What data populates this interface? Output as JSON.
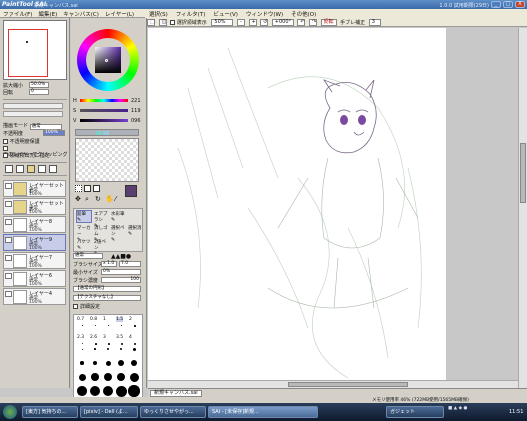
{
  "titlebar": {
    "logo": "PaintTool SAI",
    "title": "新規キャンバス.sai",
    "right": "1.0.0 試用期限(29日)",
    "min": "_",
    "max": "□",
    "close": "X"
  },
  "menubar": {
    "items": [
      "ファイル(F)",
      "編集(E)",
      "キャンバス(C)",
      "レイヤー(L)",
      "選択(S)",
      "フィルタ(T)",
      "ビュー(V)",
      "ウィンドウ(W)",
      "その他(O)"
    ]
  },
  "toolbar": {
    "show_selection": "選択領域表示",
    "zoom": "50%",
    "rotation": "+000°",
    "flip_label": "反転",
    "stabilizer_label": "手ブレ補正",
    "stabilizer": "3"
  },
  "navigator": {
    "zoom_label": "拡大縮小",
    "zoom": "50.0%",
    "angle_label": "回転",
    "angle": "0"
  },
  "left": {
    "blend_mode_label": "描画モード",
    "blend_mode": "通常",
    "opacity_label": "不透明度",
    "opacity": "100%",
    "opt1": "不透明度保護",
    "opt2": "下のレイヤーでクリッピング",
    "opt3": "領域検出元に指定",
    "layers": [
      {
        "name": "レイヤーセット1",
        "mode": "通常",
        "op": "100%",
        "folder": true,
        "sel": false
      },
      {
        "name": "レイヤーセット2",
        "mode": "通常",
        "op": "100%",
        "folder": true,
        "sel": false
      },
      {
        "name": "レイヤー8",
        "mode": "通常",
        "op": "100%",
        "folder": false,
        "sel": false
      },
      {
        "name": "レイヤー9",
        "mode": "通常",
        "op": "100%",
        "folder": false,
        "sel": true
      },
      {
        "name": "レイヤー7",
        "mode": "通常",
        "op": "100%",
        "folder": false,
        "sel": false
      },
      {
        "name": "レイヤー6",
        "mode": "通常",
        "op": "100%",
        "folder": false,
        "sel": false
      },
      {
        "name": "レイヤー4",
        "mode": "通常",
        "op": "100%",
        "folder": false,
        "sel": false
      }
    ]
  },
  "color": {
    "h_label": "H",
    "h_value": "221",
    "s_label": "S",
    "s_value": "119",
    "v_label": "V",
    "v_value": "096",
    "current_color": "#5a3f70"
  },
  "tools": {
    "row1": [
      "鉛筆",
      "エアブラシ",
      "水彩筆"
    ],
    "row2": [
      "マーカー",
      "消しゴム",
      "選択ペン",
      "選択消"
    ],
    "row3": [
      "バケツ",
      "2値ペン"
    ],
    "blend": "通常",
    "size_label": "ブラシサイズ",
    "size_mult": "x 1.0",
    "size": "7.0",
    "min_label": "最小サイズ",
    "min": "0%",
    "density_label": "ブラシ濃度",
    "density": "100",
    "shape": "【通常の円形】",
    "texture": "【テクスチャなし】",
    "detail": "詳細設定",
    "sizes_row1": [
      "0.7",
      "0.8",
      "1",
      "1.5",
      "2"
    ],
    "sizes_row2": [
      "2.3",
      "2.6",
      "3",
      "3.5",
      "4"
    ]
  },
  "canvas_tab": "新規キャンバス.sai",
  "status": {
    "memory": "メモリ使用率 46% (722MB使用/1565MB確保)"
  },
  "taskbar": {
    "tasks": [
      "[東方] 気持ちの...",
      "[pixiv] - Dell (よ...",
      "ゆっくりさせやがっ...",
      "SAI - [未保存]新規...",
      "ガジェット"
    ],
    "time": "11:51"
  }
}
